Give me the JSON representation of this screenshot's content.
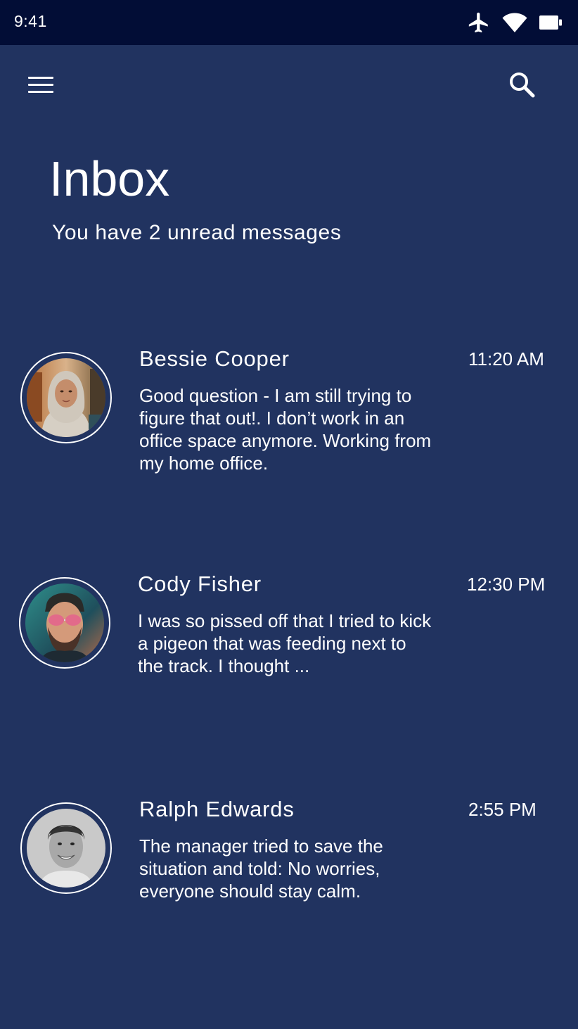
{
  "status_bar": {
    "time": "9:41",
    "icons": [
      "airplane-icon",
      "wifi-icon",
      "battery-icon"
    ]
  },
  "header": {
    "menu_icon": "hamburger-menu-icon",
    "search_icon": "search-icon"
  },
  "page": {
    "title": "Inbox",
    "subtitle": "You have 2 unread messages"
  },
  "messages": [
    {
      "sender": "Bessie Cooper",
      "time": "11:20 AM",
      "preview": "Good question - I am still trying to figure that out!. I don’t work in an office space anymore. Working from my home office."
    },
    {
      "sender": "Cody Fisher",
      "time": "12:30 PM",
      "preview": "I was so pissed off that I tried to kick a pigeon that was feeding next to the track. I thought ..."
    },
    {
      "sender": "Ralph Edwards",
      "time": "2:55 PM",
      "preview": "The manager tried to save the situation and told: No worries, everyone should stay calm."
    }
  ],
  "colors": {
    "background": "#213360",
    "status_bar": "#020d36",
    "text": "#ffffff"
  }
}
